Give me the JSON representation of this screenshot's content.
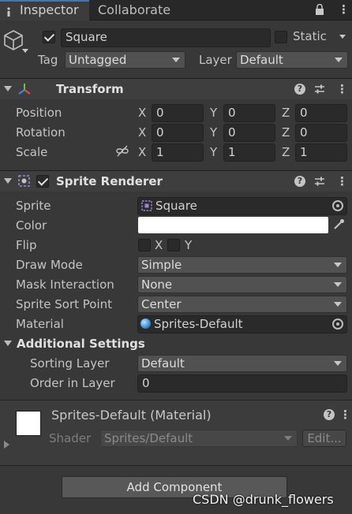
{
  "tabs": {
    "inspector": "Inspector",
    "collaborate": "Collaborate"
  },
  "gameobject": {
    "name": "Square",
    "active": true,
    "static_label": "Static",
    "static": false,
    "tag_label": "Tag",
    "tag_value": "Untagged",
    "layer_label": "Layer",
    "layer_value": "Default"
  },
  "transform": {
    "title": "Transform",
    "position_label": "Position",
    "rotation_label": "Rotation",
    "scale_label": "Scale",
    "axis_x": "X",
    "axis_y": "Y",
    "axis_z": "Z",
    "position": {
      "x": "0",
      "y": "0",
      "z": "0"
    },
    "rotation": {
      "x": "0",
      "y": "0",
      "z": "0"
    },
    "scale": {
      "x": "1",
      "y": "1",
      "z": "1"
    }
  },
  "sprite_renderer": {
    "title": "Sprite Renderer",
    "enabled": true,
    "sprite_label": "Sprite",
    "sprite_value": "Square",
    "color_label": "Color",
    "color_value": "#ffffff",
    "flip_label": "Flip",
    "flip_x": "X",
    "flip_y": "Y",
    "draw_mode_label": "Draw Mode",
    "draw_mode_value": "Simple",
    "mask_label": "Mask Interaction",
    "mask_value": "None",
    "sort_point_label": "Sprite Sort Point",
    "sort_point_value": "Center",
    "material_label": "Material",
    "material_value": "Sprites-Default",
    "additional_label": "Additional Settings",
    "sorting_layer_label": "Sorting Layer",
    "sorting_layer_value": "Default",
    "order_label": "Order in Layer",
    "order_value": "0"
  },
  "material": {
    "title": "Sprites-Default (Material)",
    "shader_label": "Shader",
    "shader_value": "Sprites/Default",
    "edit_label": "Edit..."
  },
  "footer": {
    "add_component": "Add Component",
    "watermark": "CSDN @drunk_flowers"
  },
  "icons": {
    "lock": "lock-icon",
    "menu": "kebab-menu-icon",
    "help": "help-icon",
    "preset": "preset-icon"
  }
}
